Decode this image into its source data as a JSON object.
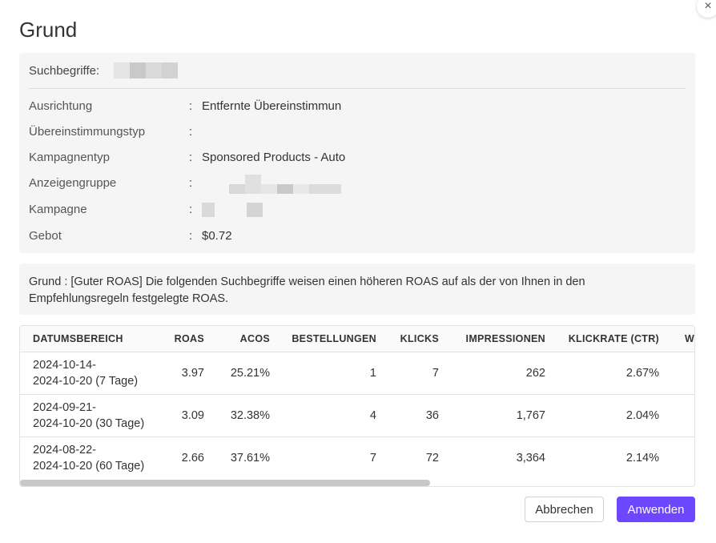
{
  "dialog": {
    "title": "Grund",
    "close_icon": "×"
  },
  "details": {
    "search_terms_label": "Suchbegriffe:",
    "rows": [
      {
        "label": "Ausrichtung",
        "sep": ":",
        "value": "Entfernte Übereinstimmun"
      },
      {
        "label": "Übereinstimmungstyp",
        "sep": ":",
        "value": ""
      },
      {
        "label": "Kampagnentyp",
        "sep": ":",
        "value": "Sponsored Products - Auto"
      },
      {
        "label": "Anzeigengruppe",
        "sep": ":",
        "value": ""
      },
      {
        "label": "Kampagne",
        "sep": ":",
        "value": ""
      },
      {
        "label": "Gebot",
        "sep": ":",
        "value": "$0.72"
      }
    ]
  },
  "reason": {
    "line1": "Grund : [Guter ROAS] Die folgenden Suchbegriffe weisen einen höheren ROAS auf als der von Ihnen in den",
    "line2": "Empfehlungsregeln festgelegte ROAS."
  },
  "table": {
    "headers": [
      "DATUMSBEREICH",
      "ROAS",
      "ACOS",
      "BESTELLUNGEN",
      "KLICKS",
      "IMPRESSIONEN",
      "KLICKRATE (CTR)",
      "W"
    ],
    "rows": [
      {
        "range1": "2024-10-14-",
        "range2": "2024-10-20 (7 Tage)",
        "roas": "3.97",
        "acos": "25.21%",
        "orders": "1",
        "clicks": "7",
        "impressions": "262",
        "ctr": "2.67%"
      },
      {
        "range1": "2024-09-21-",
        "range2": "2024-10-20 (30 Tage)",
        "roas": "3.09",
        "acos": "32.38%",
        "orders": "4",
        "clicks": "36",
        "impressions": "1,767",
        "ctr": "2.04%"
      },
      {
        "range1": "2024-08-22-",
        "range2": "2024-10-20 (60 Tage)",
        "roas": "2.66",
        "acos": "37.61%",
        "orders": "7",
        "clicks": "72",
        "impressions": "3,364",
        "ctr": "2.14%"
      }
    ]
  },
  "footer": {
    "cancel_label": "Abbrechen",
    "apply_label": "Anwenden"
  },
  "colors": {
    "accent": "#6c47ff",
    "panel_bg": "#f5f5f5"
  }
}
